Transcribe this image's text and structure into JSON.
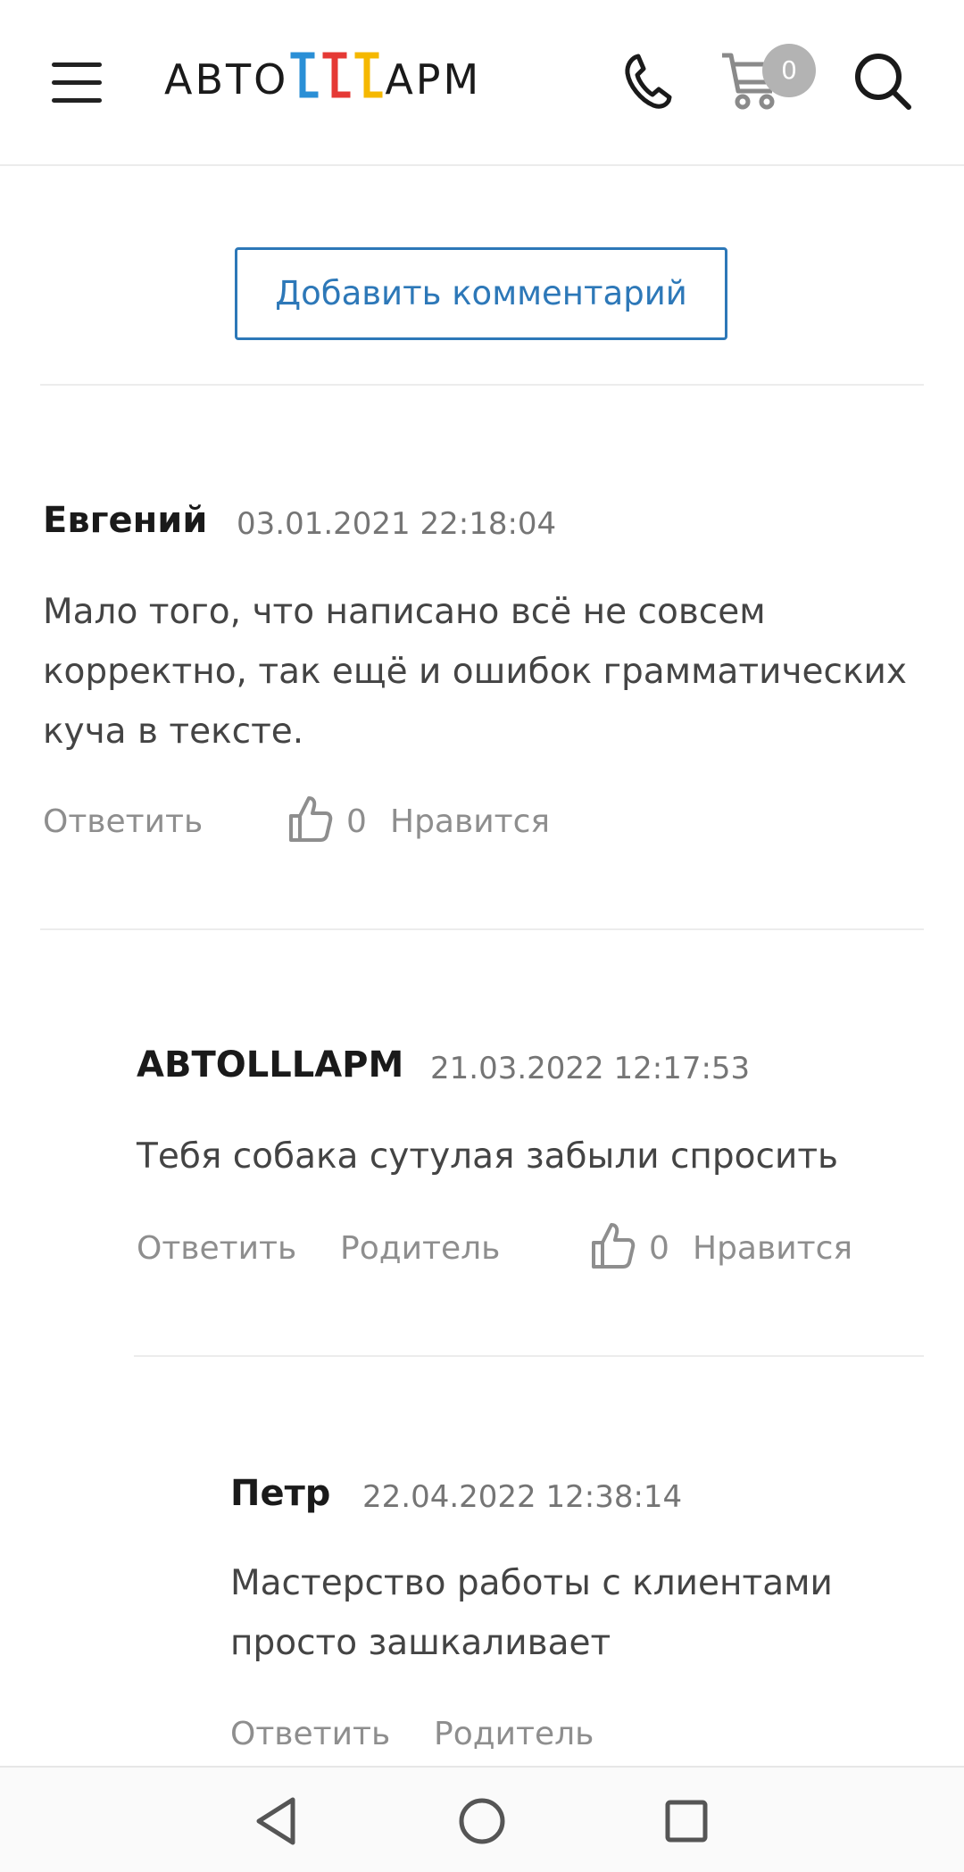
{
  "header": {
    "logo_text_left": "АВТО",
    "logo_text_right": "АРМ",
    "cart_count": "0",
    "icons": [
      "menu-icon",
      "phone-icon",
      "cart-icon",
      "search-icon"
    ]
  },
  "add_comment_label": "Добавить комментарий",
  "comments": [
    {
      "author": "Евгений",
      "date": "03.01.2021 22:18:04",
      "lines": [
        "Мало того, что написано всё не совсем",
        "корректно, так ещё и ошибок грамматических",
        "куча в тексте."
      ],
      "reply_label": "Ответить",
      "likes": "0",
      "like_label": "Нравится"
    },
    {
      "author": "АВТОLLLАРМ",
      "date": "21.03.2022 12:17:53",
      "lines": [
        "Тебя собака сутулая забыли спросить"
      ],
      "reply_label": "Ответить",
      "parent_label": "Родитель",
      "likes": "0",
      "like_label": "Нравится"
    },
    {
      "author": "Петр",
      "date": "22.04.2022 12:38:14",
      "lines": [
        "Мастерство работы с клиентами",
        "просто зашкаливает"
      ],
      "reply_label": "Ответить",
      "parent_label": "Родитель"
    }
  ],
  "colors": {
    "accent": "#2d78b8",
    "logo_blue": "#2a8fd6",
    "logo_red": "#e53935",
    "logo_yellow": "#f5b800"
  }
}
